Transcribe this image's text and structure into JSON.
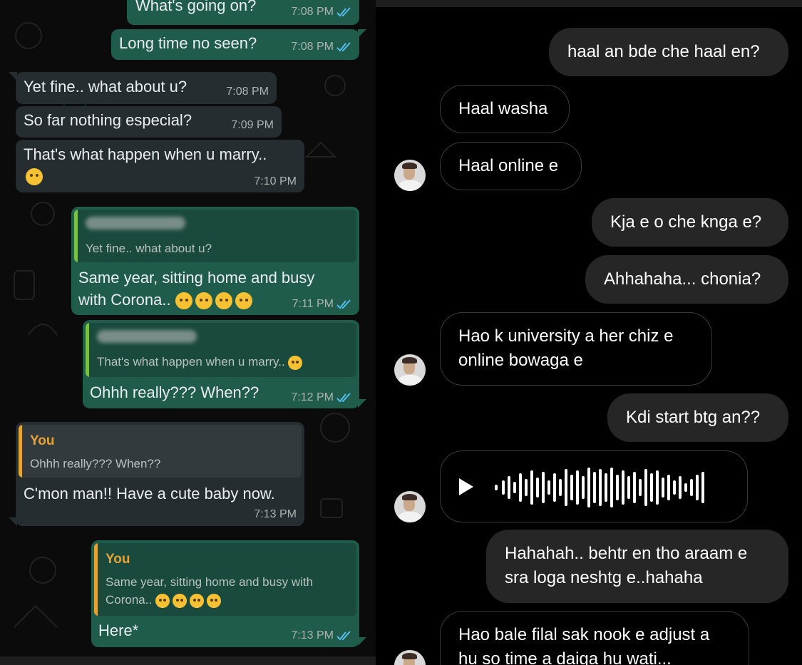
{
  "whatsapp": {
    "messages": [
      {
        "text": "What's going on?",
        "time": "7:08 PM"
      },
      {
        "text": "Long time no seen?",
        "time": "7:08 PM"
      },
      {
        "text": "Yet fine.. what about u?",
        "time": "7:08 PM"
      },
      {
        "text": "So far nothing especial?",
        "time": "7:09 PM"
      },
      {
        "text": "That's what happen when u marry..",
        "time": "7:10 PM"
      },
      {
        "quote": "Yet fine.. what about u?",
        "text1": "Same year, sitting home and busy",
        "text2": "with Corona..",
        "time": "7:11 PM"
      },
      {
        "quote": "That's what happen when u marry..",
        "text": "Ohhh really??? When??",
        "time": "7:12 PM"
      },
      {
        "quote_name": "You",
        "quote": "Ohhh really??? When??",
        "text": "C'mon man!! Have a cute baby now.",
        "time": "7:13 PM"
      },
      {
        "quote_name": "You",
        "quote1": "Same year, sitting home and busy with",
        "quote2": "Corona..",
        "text": "Here*",
        "time": "7:13 PM"
      }
    ]
  },
  "instagram": {
    "messages": [
      {
        "text": "haal an bde che haal en?"
      },
      {
        "text": "Haal washa"
      },
      {
        "text": "Haal online e"
      },
      {
        "text": "Kja e o che knga e?"
      },
      {
        "text": "Ahhahaha... chonia?"
      },
      {
        "line1": "Hao k university a her chiz e",
        "line2": "online bowaga e"
      },
      {
        "text": "Kdi start btg an??"
      },
      {
        "voice_icon": "play-icon"
      },
      {
        "line1": "Hahahah.. behtr en tho araam e",
        "line2": "sra loga neshtg e..hahaha"
      },
      {
        "line1": "Hao bale filal sak nook e adjust a",
        "line2": "hu so time a daiga hu wati..."
      }
    ]
  },
  "colors": {
    "wa_out": "#1f5c4b",
    "wa_in": "#262d31",
    "ig_sent": "#262626",
    "read_tick": "#53bdeb",
    "quote_name": "#e5a335"
  }
}
